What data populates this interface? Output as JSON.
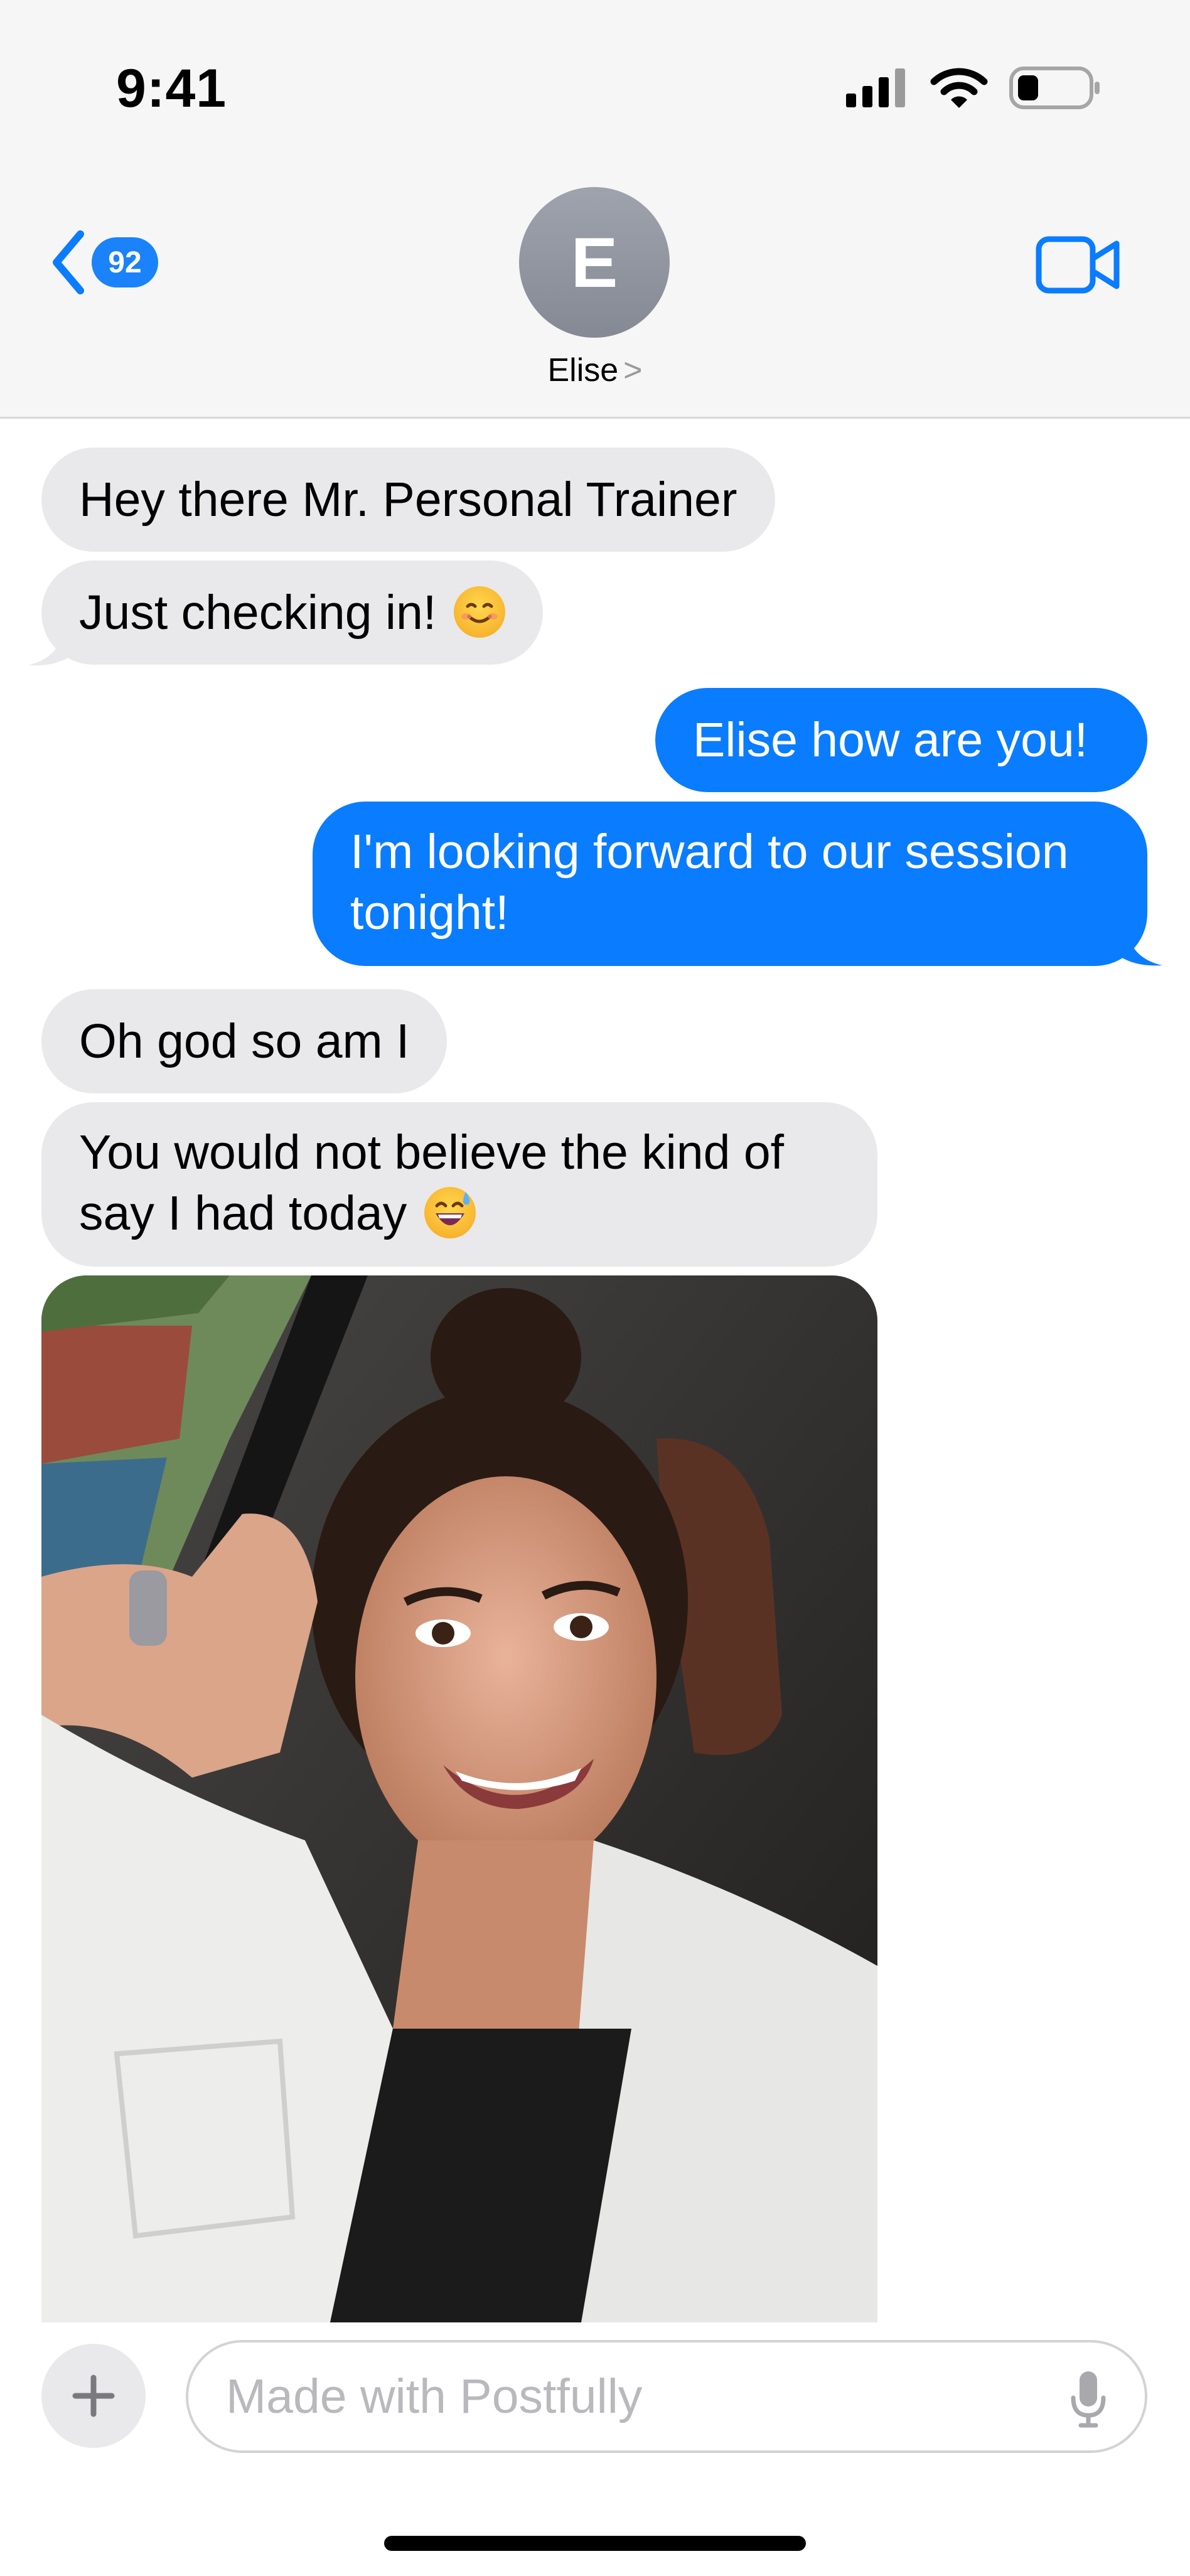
{
  "status_bar": {
    "time": "9:41"
  },
  "header": {
    "back_badge": "92",
    "avatar_initial": "E",
    "contact_name": "Elise",
    "contact_chevron": ">"
  },
  "messages": [
    {
      "from": "them",
      "text": "Hey there Mr. Personal Trainer"
    },
    {
      "from": "them",
      "text": "Just checking in!",
      "emoji": "smiling-face-emoji"
    },
    {
      "from": "me",
      "text": "Elise how are you!"
    },
    {
      "from": "me",
      "text": "I'm looking forward to our session tonight!"
    },
    {
      "from": "them",
      "text": "Oh god so am I"
    },
    {
      "from": "them",
      "text": "You would not believe the kind of say I had today",
      "emoji": "grinning-sweat-emoji"
    },
    {
      "from": "them",
      "type": "photo"
    }
  ],
  "composer": {
    "placeholder": "Made with Postfully"
  },
  "colors": {
    "accent": "#0a7cff",
    "incoming_bubble": "#e9e9eb"
  }
}
